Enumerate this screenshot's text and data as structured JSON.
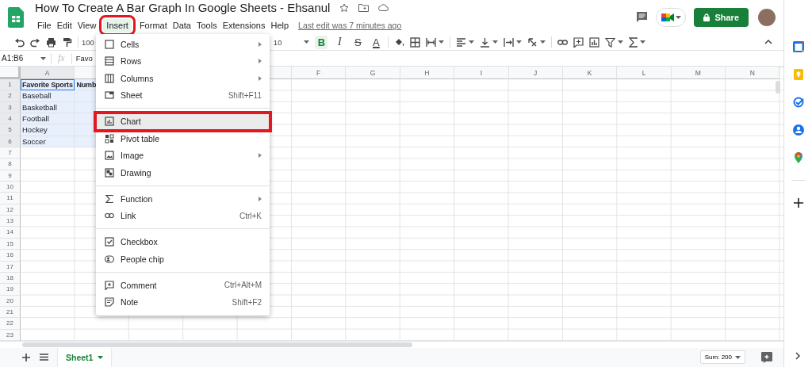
{
  "header": {
    "title": "How To Create A Bar Graph In Google Sheets - Ehsanul",
    "menus": [
      {
        "label": "File",
        "selected": false,
        "framed": false
      },
      {
        "label": "Edit",
        "selected": false,
        "framed": false
      },
      {
        "label": "View",
        "selected": false,
        "framed": false
      },
      {
        "label": "Insert",
        "selected": true,
        "framed": true
      },
      {
        "label": "Format",
        "selected": false,
        "framed": false
      },
      {
        "label": "Data",
        "selected": false,
        "framed": false
      },
      {
        "label": "Tools",
        "selected": false,
        "framed": false
      },
      {
        "label": "Extensions",
        "selected": false,
        "framed": false
      },
      {
        "label": "Help",
        "selected": false,
        "framed": false
      }
    ],
    "last_edit": "Last edit was 7 minutes ago",
    "share_label": "Share"
  },
  "toolbar": {
    "zoom": "100",
    "font_size": "10",
    "format_buttons": [
      {
        "label": "B",
        "active": true
      },
      {
        "label": "I",
        "active": false
      },
      {
        "label": "S",
        "active": false
      },
      {
        "label": "A",
        "active": false
      }
    ]
  },
  "formula_bar": {
    "name_box": "A1:B6",
    "fx": "fx",
    "content": "Favo"
  },
  "grid": {
    "column_headers_left": [
      {
        "label": "A",
        "selected": true
      }
    ],
    "column_headers_right": [
      {
        "label": "F",
        "selected": false
      },
      {
        "label": "G",
        "selected": false
      },
      {
        "label": "H",
        "selected": false
      },
      {
        "label": "I",
        "selected": false
      },
      {
        "label": "J",
        "selected": false
      },
      {
        "label": "K",
        "selected": false
      },
      {
        "label": "L",
        "selected": false
      },
      {
        "label": "M",
        "selected": false
      },
      {
        "label": "N",
        "selected": false
      }
    ],
    "rows": [
      {
        "number": "1",
        "selected": true,
        "bold": true,
        "cells": [
          "Favorite Sports",
          "Numb"
        ]
      },
      {
        "number": "2",
        "selected": true,
        "cells": [
          "Baseball"
        ]
      },
      {
        "number": "3",
        "selected": true,
        "cells": [
          "Basketball"
        ]
      },
      {
        "number": "4",
        "selected": true,
        "cells": [
          "Football"
        ]
      },
      {
        "number": "5",
        "selected": true,
        "cells": [
          "Hockey"
        ]
      },
      {
        "number": "6",
        "selected": true,
        "cells": [
          "Soccer"
        ]
      },
      {
        "number": "7",
        "selected": false
      },
      {
        "number": "8",
        "selected": false
      },
      {
        "number": "9",
        "selected": false
      },
      {
        "number": "10",
        "selected": false
      },
      {
        "number": "11",
        "selected": false
      },
      {
        "number": "12",
        "selected": false
      },
      {
        "number": "13",
        "selected": false
      },
      {
        "number": "14",
        "selected": false
      },
      {
        "number": "15",
        "selected": false
      },
      {
        "number": "16",
        "selected": false
      },
      {
        "number": "17",
        "selected": false
      },
      {
        "number": "18",
        "selected": false
      },
      {
        "number": "19",
        "selected": false
      },
      {
        "number": "20",
        "selected": false
      },
      {
        "number": "21",
        "selected": false
      },
      {
        "number": "22",
        "selected": false
      },
      {
        "number": "23",
        "selected": false
      }
    ]
  },
  "insert_menu": {
    "items": [
      {
        "kind": "item",
        "label": "Cells",
        "submenu": true,
        "selected": false,
        "framed": false
      },
      {
        "kind": "item",
        "label": "Rows",
        "submenu": true,
        "selected": false,
        "framed": false
      },
      {
        "kind": "item",
        "label": "Columns",
        "submenu": true,
        "selected": false,
        "framed": false
      },
      {
        "kind": "item",
        "label": "Sheet",
        "shortcut": "Shift+F11",
        "submenu": false,
        "selected": false,
        "framed": false
      },
      {
        "kind": "divider"
      },
      {
        "kind": "item",
        "label": "Chart",
        "submenu": false,
        "selected": true,
        "framed": true
      },
      {
        "kind": "item",
        "label": "Pivot table",
        "submenu": false,
        "selected": false,
        "framed": false
      },
      {
        "kind": "item",
        "label": "Image",
        "submenu": true,
        "selected": false,
        "framed": false
      },
      {
        "kind": "item",
        "label": "Drawing",
        "submenu": false,
        "selected": false,
        "framed": false
      },
      {
        "kind": "divider"
      },
      {
        "kind": "item",
        "label": "Function",
        "submenu": true,
        "selected": false,
        "framed": false
      },
      {
        "kind": "item",
        "label": "Link",
        "shortcut": "Ctrl+K",
        "submenu": false,
        "selected": false,
        "framed": false
      },
      {
        "kind": "divider"
      },
      {
        "kind": "item",
        "label": "Checkbox",
        "submenu": false,
        "selected": false,
        "framed": false
      },
      {
        "kind": "item",
        "label": "People chip",
        "submenu": false,
        "selected": false,
        "framed": false
      },
      {
        "kind": "divider"
      },
      {
        "kind": "item",
        "label": "Comment",
        "shortcut": "Ctrl+Alt+M",
        "submenu": false,
        "selected": false,
        "framed": false
      },
      {
        "kind": "item",
        "label": "Note",
        "shortcut": "Shift+F2",
        "submenu": false,
        "selected": false,
        "framed": false
      }
    ]
  },
  "bottom_bar": {
    "sheets": [
      {
        "label": "Sheet1",
        "selected": true
      }
    ],
    "sum": "Sum: 200"
  }
}
